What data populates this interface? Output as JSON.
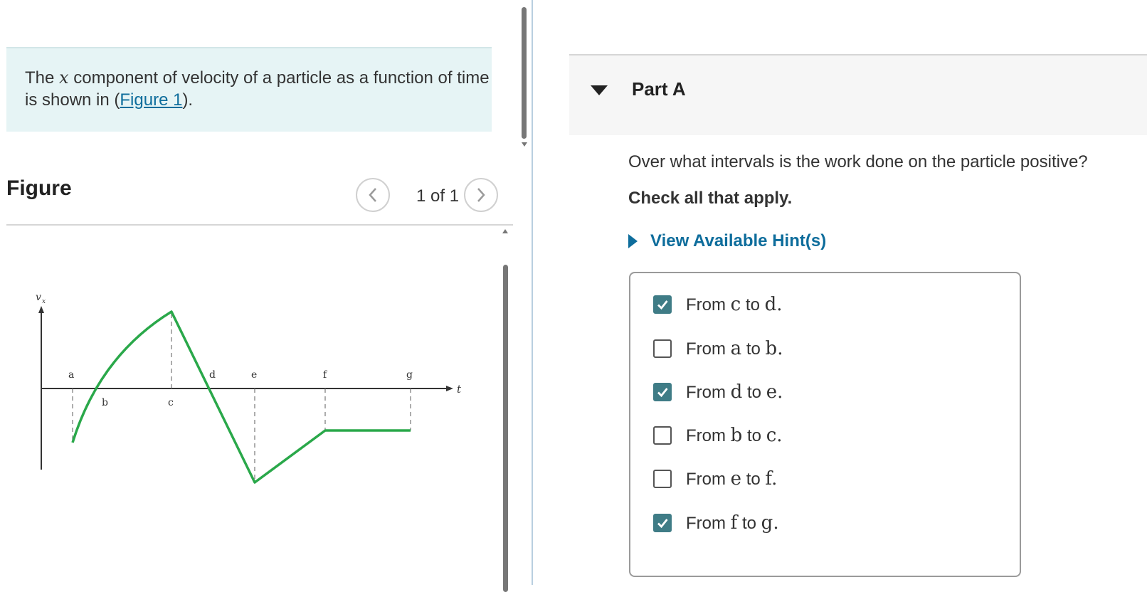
{
  "intro": {
    "prefix": "The ",
    "variable": "x",
    "middle": " component of velocity of a particle as a function of time is shown in (",
    "link": "Figure 1",
    "suffix": ")."
  },
  "figure": {
    "heading": "Figure",
    "counter": "1 of 1",
    "graph": {
      "ylabel": "v",
      "ylabel_sub": "x",
      "xlabel": "t",
      "point_labels": [
        "a",
        "b",
        "c",
        "d",
        "e",
        "f",
        "g"
      ],
      "line_color": "#2aa84a"
    }
  },
  "part": {
    "title": "Part A",
    "question": "Over what intervals is the work done on the particle positive?",
    "instruction": "Check all that apply.",
    "hint_label": "View Available Hint(s)",
    "options": [
      {
        "pre": "From ",
        "a": "c",
        "mid": " to ",
        "b": "d",
        "end": ".",
        "checked": true
      },
      {
        "pre": "From ",
        "a": "a",
        "mid": " to ",
        "b": "b",
        "end": ".",
        "checked": false
      },
      {
        "pre": "From ",
        "a": "d",
        "mid": " to ",
        "b": "e",
        "end": ".",
        "checked": true
      },
      {
        "pre": "From ",
        "a": "b",
        "mid": " to ",
        "b": "c",
        "end": ".",
        "checked": false
      },
      {
        "pre": "From ",
        "a": "e",
        "mid": " to ",
        "b": "f",
        "end": ".",
        "checked": false
      },
      {
        "pre": "From ",
        "a": "f",
        "mid": " to ",
        "b": "g",
        "end": ".",
        "checked": true
      }
    ]
  },
  "colors": {
    "link": "#0e6d9c",
    "checked": "#3f7c86",
    "intro_bg": "#e6f4f5"
  }
}
